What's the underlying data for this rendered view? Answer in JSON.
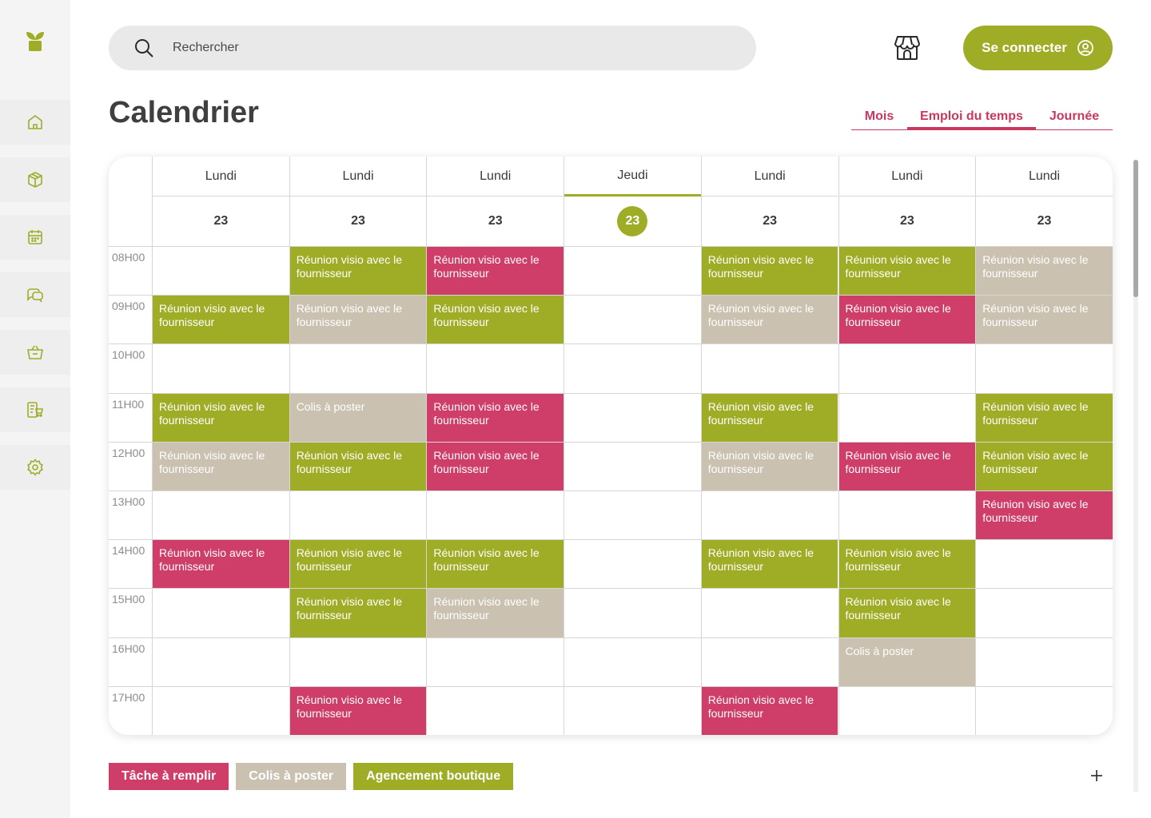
{
  "sidebar": {
    "logo": "plant-logo",
    "items": [
      {
        "name": "home-icon"
      },
      {
        "name": "box-icon"
      },
      {
        "name": "calendar-icon"
      },
      {
        "name": "chat-icon"
      },
      {
        "name": "basket-icon"
      },
      {
        "name": "order-cart-icon"
      },
      {
        "name": "settings-icon"
      }
    ]
  },
  "header": {
    "search_placeholder": "Rechercher",
    "connect_label": "Se connecter"
  },
  "page": {
    "title": "Calendrier",
    "tabs": [
      {
        "label": "Mois",
        "active": false
      },
      {
        "label": "Emploi du temps",
        "active": true
      },
      {
        "label": "Journée",
        "active": false
      }
    ]
  },
  "calendar": {
    "days": [
      {
        "name": "Lundi",
        "num": "23",
        "today": false
      },
      {
        "name": "Lundi",
        "num": "23",
        "today": false
      },
      {
        "name": "Lundi",
        "num": "23",
        "today": false
      },
      {
        "name": "Jeudi",
        "num": "23",
        "today": true
      },
      {
        "name": "Lundi",
        "num": "23",
        "today": false
      },
      {
        "name": "Lundi",
        "num": "23",
        "today": false
      },
      {
        "name": "Lundi",
        "num": "23",
        "today": false
      }
    ],
    "hours": [
      "08H00",
      "09H00",
      "10H00",
      "11H00",
      "12H00",
      "13H00",
      "14H00",
      "15H00",
      "16H00",
      "17H00"
    ],
    "events": [
      {
        "day": 1,
        "hour": 0,
        "type": "green",
        "text": "Réunion visio avec le fournisseur"
      },
      {
        "day": 2,
        "hour": 0,
        "type": "pink",
        "text": "Réunion visio avec le fournisseur"
      },
      {
        "day": 4,
        "hour": 0,
        "type": "green",
        "text": "Réunion visio avec le fournisseur"
      },
      {
        "day": 5,
        "hour": 0,
        "type": "green",
        "text": "Réunion visio avec le fournisseur"
      },
      {
        "day": 6,
        "hour": 0,
        "type": "beige",
        "text": "Réunion visio avec le fournisseur"
      },
      {
        "day": 0,
        "hour": 1,
        "type": "green",
        "text": "Réunion visio avec le fournisseur"
      },
      {
        "day": 1,
        "hour": 1,
        "type": "beige",
        "text": "Réunion visio avec le fournisseur"
      },
      {
        "day": 2,
        "hour": 1,
        "type": "green",
        "text": "Réunion visio avec le fournisseur"
      },
      {
        "day": 4,
        "hour": 1,
        "type": "beige",
        "text": "Réunion visio avec le fournisseur"
      },
      {
        "day": 5,
        "hour": 1,
        "type": "pink",
        "text": "Réunion visio avec le fournisseur"
      },
      {
        "day": 6,
        "hour": 1,
        "type": "beige",
        "text": "Réunion visio avec le fournisseur"
      },
      {
        "day": 0,
        "hour": 3,
        "type": "green",
        "text": "Réunion visio avec le fournisseur"
      },
      {
        "day": 1,
        "hour": 3,
        "type": "beige",
        "text": "Colis à poster"
      },
      {
        "day": 2,
        "hour": 3,
        "type": "pink",
        "text": "Réunion visio avec le fournisseur"
      },
      {
        "day": 4,
        "hour": 3,
        "type": "green",
        "text": "Réunion visio avec le fournisseur"
      },
      {
        "day": 6,
        "hour": 3,
        "type": "green",
        "text": "Réunion visio avec le fournisseur"
      },
      {
        "day": 0,
        "hour": 4,
        "type": "beige",
        "text": "Réunion visio avec le fournisseur"
      },
      {
        "day": 1,
        "hour": 4,
        "type": "green",
        "text": "Réunion visio avec le fournisseur"
      },
      {
        "day": 2,
        "hour": 4,
        "type": "pink",
        "text": "Réunion visio avec le fournisseur"
      },
      {
        "day": 4,
        "hour": 4,
        "type": "beige",
        "text": "Réunion visio avec le fournisseur"
      },
      {
        "day": 5,
        "hour": 4,
        "type": "pink",
        "text": "Réunion visio avec le fournisseur"
      },
      {
        "day": 6,
        "hour": 4,
        "type": "green",
        "text": "Réunion visio avec le fournisseur"
      },
      {
        "day": 6,
        "hour": 5,
        "type": "pink",
        "text": "Réunion visio avec le fournisseur"
      },
      {
        "day": 0,
        "hour": 6,
        "type": "pink",
        "text": "Réunion visio avec le fournisseur"
      },
      {
        "day": 1,
        "hour": 6,
        "type": "green",
        "text": "Réunion visio avec le fournisseur"
      },
      {
        "day": 2,
        "hour": 6,
        "type": "green",
        "text": "Réunion visio avec le fournisseur"
      },
      {
        "day": 4,
        "hour": 6,
        "type": "green",
        "text": "Réunion visio avec le fournisseur"
      },
      {
        "day": 5,
        "hour": 6,
        "type": "green",
        "text": "Réunion visio avec le fournisseur"
      },
      {
        "day": 1,
        "hour": 7,
        "type": "green",
        "text": "Réunion visio avec le fournisseur"
      },
      {
        "day": 2,
        "hour": 7,
        "type": "beige",
        "text": "Réunion visio avec le fournisseur"
      },
      {
        "day": 5,
        "hour": 7,
        "type": "green",
        "text": "Réunion visio avec le fournisseur"
      },
      {
        "day": 5,
        "hour": 8,
        "type": "beige",
        "text": "Colis à poster"
      },
      {
        "day": 1,
        "hour": 9,
        "type": "pink",
        "text": "Réunion visio avec le fournisseur"
      },
      {
        "day": 4,
        "hour": 9,
        "type": "pink",
        "text": "Réunion visio avec le fournisseur"
      }
    ]
  },
  "legend": [
    {
      "label": "Tâche à remplir",
      "type": "pink"
    },
    {
      "label": "Colis à poster",
      "type": "beige"
    },
    {
      "label": "Agencement boutique",
      "type": "green"
    }
  ],
  "colors": {
    "green": "#9fad26",
    "pink": "#cf3d69",
    "beige": "#cbc1b1",
    "tab_accent": "#c9385f"
  }
}
